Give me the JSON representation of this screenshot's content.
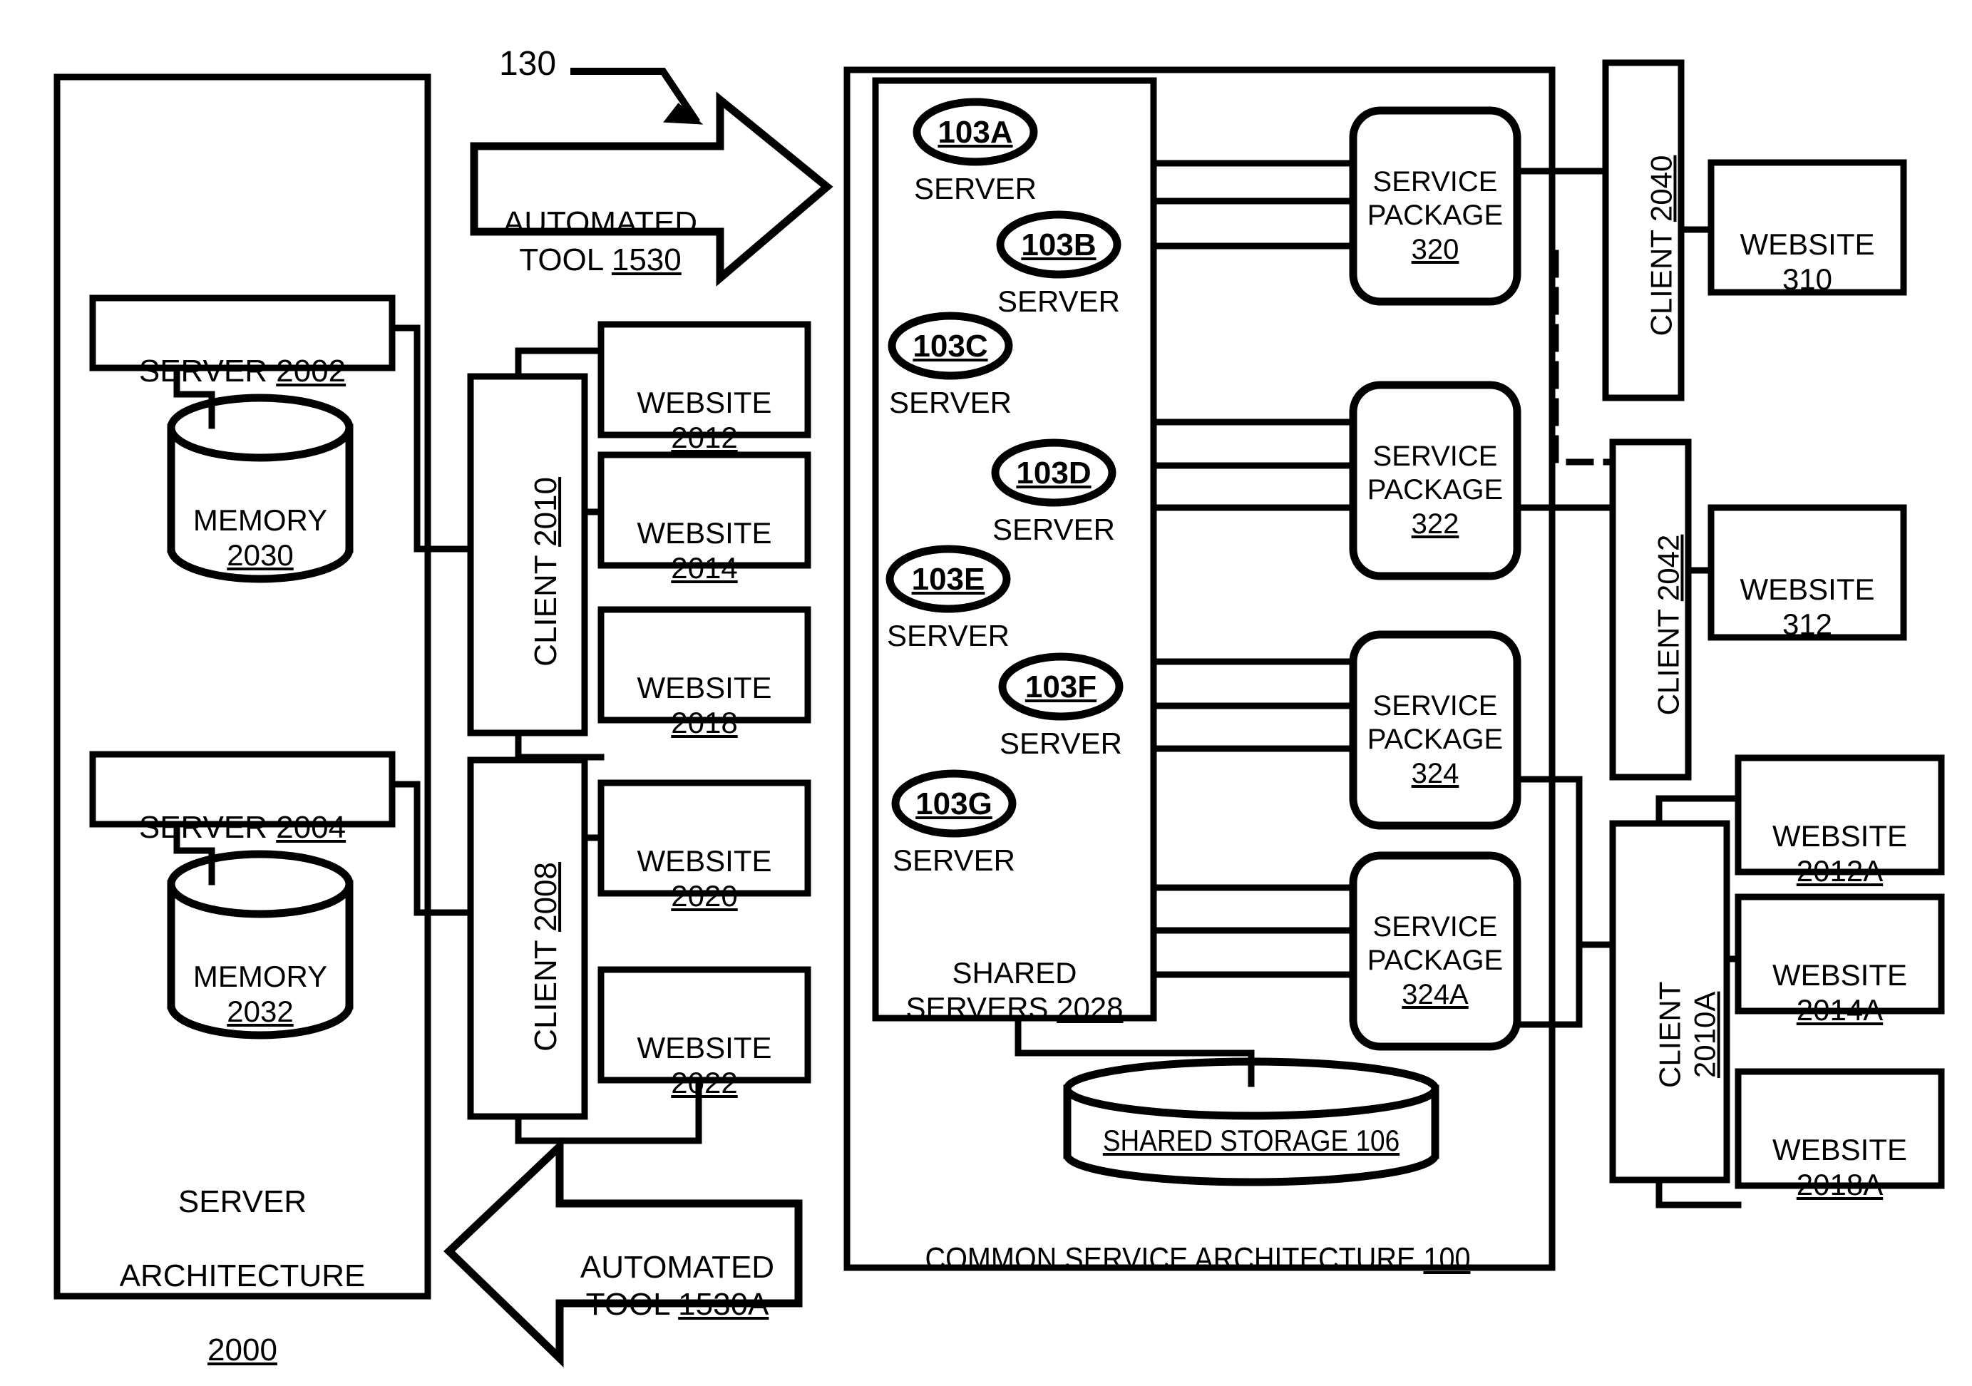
{
  "figure": {
    "reference_callout": "130",
    "server_architecture_label": "SERVER\nARCHITECTURE\n2000",
    "server_architecture_id": "2000",
    "common_service_architecture_label": "COMMON SERVICE ARCHITECTURE 100",
    "shared_servers_label": "SHARED\nSERVERS 2028",
    "shared_storage_label": "SHARED STORAGE 106"
  },
  "left_architecture": {
    "servers": [
      {
        "label": "SERVER 2002",
        "name": "SERVER",
        "id": "2002"
      },
      {
        "label": "SERVER 2004",
        "name": "SERVER",
        "id": "2004"
      }
    ],
    "memories": [
      {
        "label": "MEMORY\n2030",
        "name": "MEMORY",
        "id": "2030"
      },
      {
        "label": "MEMORY\n2032",
        "name": "MEMORY",
        "id": "2032"
      }
    ],
    "clients": [
      {
        "name": "CLIENT",
        "id": "2010"
      },
      {
        "name": "CLIENT",
        "id": "2008"
      }
    ],
    "websites": [
      {
        "label": "WEBSITE\n2012",
        "name": "WEBSITE",
        "id": "2012"
      },
      {
        "label": "WEBSITE\n2014",
        "name": "WEBSITE",
        "id": "2014"
      },
      {
        "label": "WEBSITE\n2018",
        "name": "WEBSITE",
        "id": "2018"
      },
      {
        "label": "WEBSITE\n2020",
        "name": "WEBSITE",
        "id": "2020"
      },
      {
        "label": "WEBSITE\n2022",
        "name": "WEBSITE",
        "id": "2022"
      }
    ]
  },
  "automated_tools": [
    {
      "label": "AUTOMATED\nTOOL 1530",
      "id": "1530",
      "direction": "right"
    },
    {
      "label": "AUTOMATED\nTOOL 1530A",
      "id": "1530A",
      "direction": "left"
    }
  ],
  "shared_servers": {
    "title": "SHARED\nSERVERS 2028",
    "id": "2028",
    "nodes": [
      {
        "id": "103A",
        "caption": "SERVER"
      },
      {
        "id": "103B",
        "caption": "SERVER"
      },
      {
        "id": "103C",
        "caption": "SERVER"
      },
      {
        "id": "103D",
        "caption": "SERVER"
      },
      {
        "id": "103E",
        "caption": "SERVER"
      },
      {
        "id": "103F",
        "caption": "SERVER"
      },
      {
        "id": "103G",
        "caption": "SERVER"
      }
    ]
  },
  "service_packages": [
    {
      "label": "SERVICE\nPACKAGE\n320",
      "name": "SERVICE PACKAGE",
      "id": "320"
    },
    {
      "label": "SERVICE\nPACKAGE\n322",
      "name": "SERVICE PACKAGE",
      "id": "322"
    },
    {
      "label": "SERVICE\nPACKAGE\n324",
      "name": "SERVICE PACKAGE",
      "id": "324"
    },
    {
      "label": "SERVICE\nPACKAGE\n324A",
      "name": "SERVICE PACKAGE",
      "id": "324A"
    }
  ],
  "right_clients": [
    {
      "name": "CLIENT",
      "id": "2040",
      "label": "CLIENT 2040"
    },
    {
      "name": "CLIENT",
      "id": "2042",
      "label": "CLIENT 2042"
    },
    {
      "name": "CLIENT",
      "id": "2010A",
      "label": "CLIENT\n2010A"
    }
  ],
  "right_websites": [
    {
      "label": "WEBSITE\n310",
      "name": "WEBSITE",
      "id": "310"
    },
    {
      "label": "WEBSITE\n312",
      "name": "WEBSITE",
      "id": "312"
    },
    {
      "label": "WEBSITE\n2012A",
      "name": "WEBSITE",
      "id": "2012A"
    },
    {
      "label": "WEBSITE\n2014A",
      "name": "WEBSITE",
      "id": "2014A"
    },
    {
      "label": "WEBSITE\n2018A",
      "name": "WEBSITE",
      "id": "2018A"
    }
  ],
  "style": {
    "stroke": "#000000",
    "background": "#ffffff"
  }
}
